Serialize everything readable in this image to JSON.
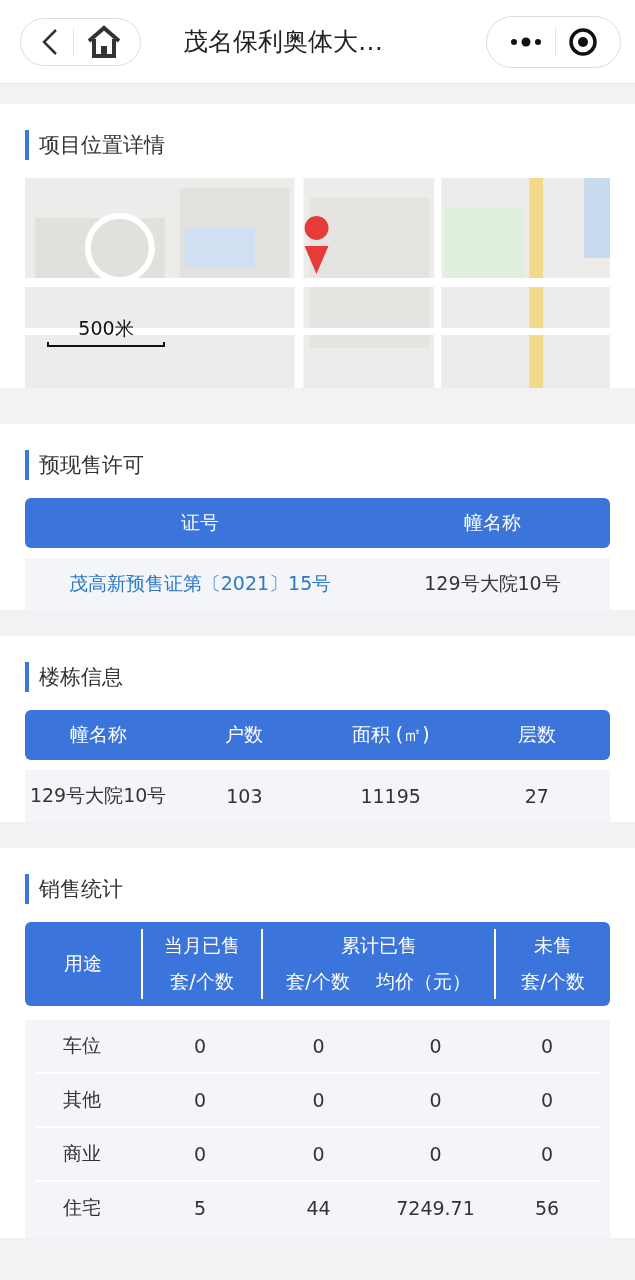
{
  "nav": {
    "title": "茂名保利奥体大…"
  },
  "location": {
    "title": "项目位置详情",
    "map": {
      "kind": "picture",
      "scale": "500米"
    }
  },
  "permit": {
    "title": "预现售许可",
    "columns": [
      "证号",
      "幢名称"
    ],
    "rows": [
      {
        "license": "茂高新预售证第〔2021〕15号",
        "building": "129号大院10号"
      }
    ]
  },
  "buildings": {
    "title": "楼栋信息",
    "columns": [
      "幢名称",
      "户数",
      "面积 (㎡)",
      "层数"
    ],
    "rows": [
      [
        "129号大院10号",
        "103",
        "11195",
        "27"
      ]
    ]
  },
  "sales": {
    "title": "销售统计",
    "header": {
      "usage": "用途",
      "month": {
        "title": "当月已售",
        "sub": "套/个数"
      },
      "total": {
        "title": "累计已售",
        "sub": [
          "套/个数",
          "均价（元）"
        ]
      },
      "unsold": {
        "title": "未售",
        "sub": "套/个数"
      }
    },
    "rows": [
      [
        "车位",
        "0",
        "0",
        "0",
        "0"
      ],
      [
        "其他",
        "0",
        "0",
        "0",
        "0"
      ],
      [
        "商业",
        "0",
        "0",
        "0",
        "0"
      ],
      [
        "住宅",
        "5",
        "44",
        "7249.71",
        "56"
      ]
    ]
  }
}
